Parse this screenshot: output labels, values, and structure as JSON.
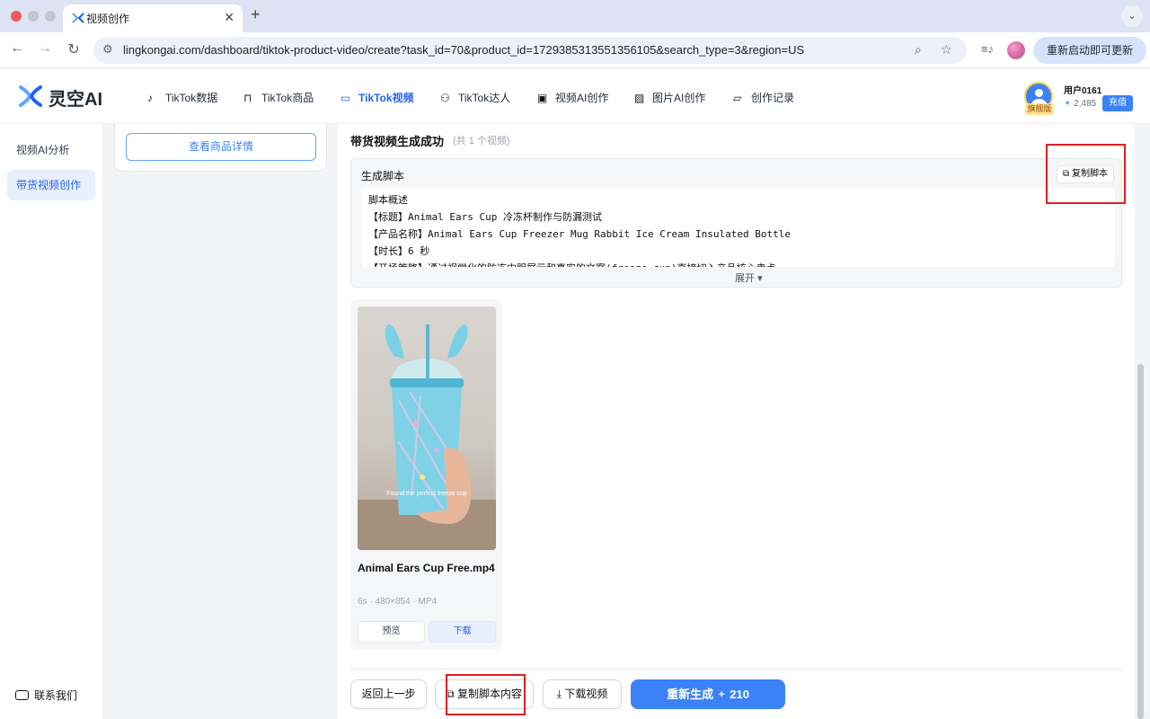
{
  "browser": {
    "tab_title": "视频创作",
    "url": "lingkongai.com/dashboard/tiktok-product-video/create?task_id=70&product_id=1729385313551356105&search_type=3&region=US",
    "restart_label": "重新启动即可更新"
  },
  "app": {
    "logo_text": "灵空AI",
    "nav": [
      {
        "label": "TikTok数据",
        "icon": "tiktok-icon"
      },
      {
        "label": "TikTok商品",
        "icon": "shopping-bag-icon"
      },
      {
        "label": "TikTok视频",
        "icon": "video-camera-icon",
        "active": true
      },
      {
        "label": "TikTok达人",
        "icon": "users-icon"
      },
      {
        "label": "视频AI创作",
        "icon": "film-icon"
      },
      {
        "label": "图片AI创作",
        "icon": "image-icon"
      },
      {
        "label": "创作记录",
        "icon": "folder-icon"
      }
    ],
    "user": {
      "name": "用户0161",
      "badge": "旗舰版",
      "credits": "2,485",
      "recharge_label": "充值"
    }
  },
  "sidebar": {
    "items": [
      {
        "label": "视频AI分析",
        "active": false
      },
      {
        "label": "带货视频创作",
        "active": true
      }
    ],
    "contact_label": "联系我们"
  },
  "product_panel": {
    "detail_button": "查看商品详情"
  },
  "main": {
    "title": "带货视频生成成功",
    "count": "(共 1 个视频)",
    "script": {
      "label": "生成脚本",
      "copy_label": "复制脚本",
      "lines": [
        "脚本概述",
        "【标题】Animal Ears Cup 冷冻杯制作与防漏测试",
        "【产品名称】Animal Ears Cup Freezer Mug Rabbit Ice Cream Insulated Bottle",
        "【时长】6 秒",
        "【开场策略】通过视觉化的防冻内胆展示和真实的文案(freeze cup)直接切入产品核心卖点"
      ],
      "expand_label": "展开"
    },
    "video": {
      "name": "Animal Ears Cup Free.mp4",
      "meta": "6s · 480×854 · MP4",
      "caption": "Found the perfect freeze cup",
      "preview_label": "预览",
      "download_label": "下载"
    },
    "actions": {
      "back_label": "返回上一步",
      "copy_content_label": "复制脚本内容",
      "download_video_label": "下载视频",
      "regenerate_label": "重新生成",
      "regenerate_cost": "210"
    }
  },
  "colors": {
    "accent": "#3b82f6",
    "highlight": "#e11d1d",
    "active_bg": "#e8f0fd"
  }
}
